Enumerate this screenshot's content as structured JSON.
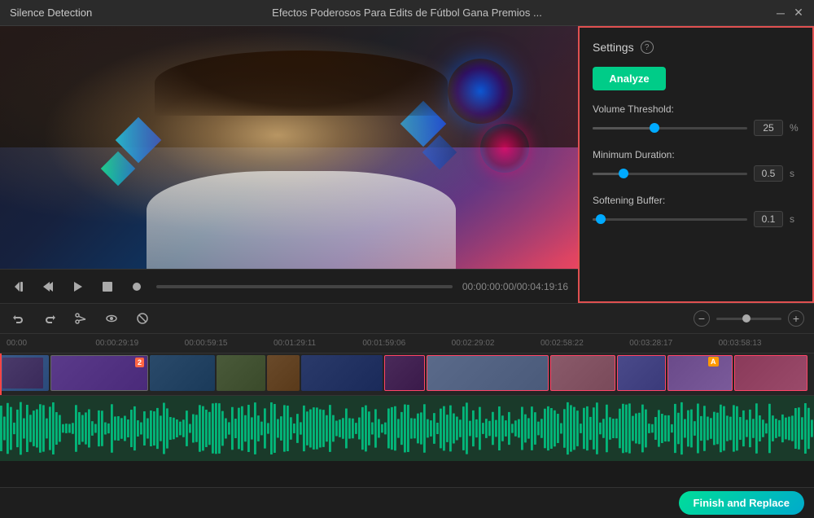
{
  "titleBar": {
    "appTitle": "Silence Detection",
    "videoTitle": "Efectos Poderosos Para Edits de Fútbol  Gana Premios ...",
    "minimizeIcon": "─",
    "closeIcon": "✕"
  },
  "videoControls": {
    "backwardIcon": "⏮",
    "playIcon": "▶",
    "forwardIcon": "▶▶",
    "stopIcon": "■",
    "recordIcon": "⏺",
    "timeDisplay": "00:00:00:00/00:04:19:16"
  },
  "settings": {
    "title": "Settings",
    "helpIcon": "?",
    "analyzeLabel": "Analyze",
    "volumeThreshold": {
      "label": "Volume Threshold:",
      "value": "25",
      "unit": "%",
      "fillPercent": 40
    },
    "minimumDuration": {
      "label": "Minimum Duration:",
      "value": "0.5",
      "unit": "s",
      "fillPercent": 20
    },
    "softeningBuffer": {
      "label": "Softening Buffer:",
      "value": "0.1",
      "unit": "s",
      "fillPercent": 5
    }
  },
  "toolbar": {
    "undoIcon": "↩",
    "redoIcon": "↪",
    "scissorsIcon": "✂",
    "eyeIcon": "👁",
    "disabledIcon": "⊘",
    "zoomMinusLabel": "−",
    "zoomPlusLabel": "+"
  },
  "timeline": {
    "rulerMarks": [
      "00:00",
      "00:00:29:19",
      "00:00:59:15",
      "00:01:29:11",
      "00:01:59:06",
      "00:02:29:02",
      "00:02:58:22",
      "00:03:28:17",
      "00:03:58:13"
    ]
  },
  "bottomBar": {
    "finishLabel": "Finish and Replace"
  }
}
